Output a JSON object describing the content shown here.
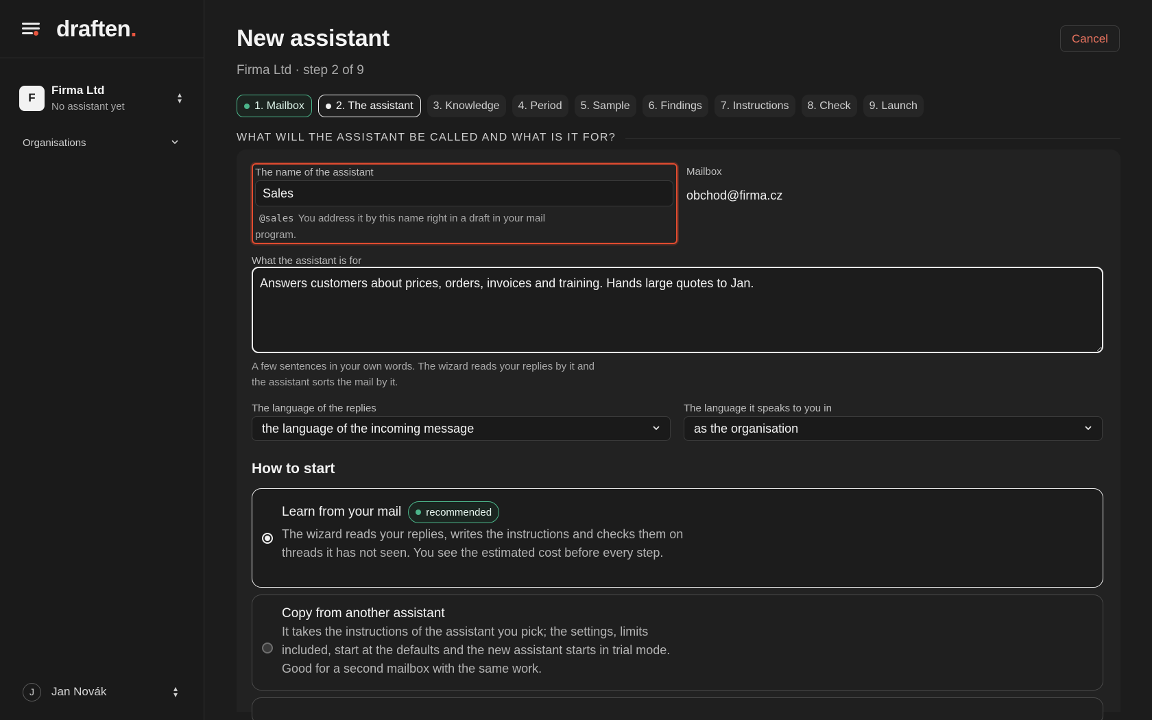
{
  "sidebar": {
    "logo": "draften",
    "logo_dot": ".",
    "org": {
      "initial": "F",
      "name": "Firma Ltd",
      "status": "No assistant yet"
    },
    "organisations_label": "Organisations",
    "user": {
      "initial": "J",
      "name": "Jan Novák"
    }
  },
  "header": {
    "title": "New assistant",
    "subtitle": "Firma Ltd · step 2 of 9",
    "cancel_label": "Cancel"
  },
  "steps": [
    {
      "label": "1. Mailbox",
      "state": "done"
    },
    {
      "label": "2. The assistant",
      "state": "current"
    },
    {
      "label": "3. Knowledge",
      "state": "todo"
    },
    {
      "label": "4. Period",
      "state": "todo"
    },
    {
      "label": "5. Sample",
      "state": "todo"
    },
    {
      "label": "6. Findings",
      "state": "todo"
    },
    {
      "label": "7. Instructions",
      "state": "todo"
    },
    {
      "label": "8. Check",
      "state": "todo"
    },
    {
      "label": "9. Launch",
      "state": "todo"
    }
  ],
  "section_title": "WHAT WILL THE ASSISTANT BE CALLED AND WHAT IS IT FOR?",
  "form": {
    "name_label": "The name of the assistant",
    "name_value": "Sales",
    "handle": "@sales",
    "name_hint": "You address it by this name right in a draft in your mail program.",
    "mailbox_label": "Mailbox",
    "mailbox_value": "obchod@firma.cz",
    "purpose_label": "What the assistant is for",
    "purpose_value": "Answers customers about prices, orders, invoices and training. Hands large quotes to Jan.",
    "purpose_hint": "A few sentences in your own words. The wizard reads your replies by it and the assistant sorts the mail by it.",
    "reply_lang_label": "The language of the replies",
    "reply_lang_value": "the language of the incoming message",
    "ui_lang_label": "The language it speaks to you in",
    "ui_lang_value": "as the organisation"
  },
  "start": {
    "title": "How to start",
    "options": [
      {
        "title": "Learn from your mail",
        "badge": "recommended",
        "desc": "The wizard reads your replies, writes the instructions and checks them on threads it has not seen. You see the estimated cost before every step.",
        "selected": true
      },
      {
        "title": "Copy from another assistant",
        "desc": "It takes the instructions of the assistant you pick; the settings, limits included, start at the defaults and the new assistant starts in trial mode. Good for a second mailbox with the same work.",
        "selected": false
      }
    ]
  },
  "colors": {
    "accent_red": "#e8553f",
    "success_green": "#4bb58a",
    "focus_error": "#e24c30"
  }
}
